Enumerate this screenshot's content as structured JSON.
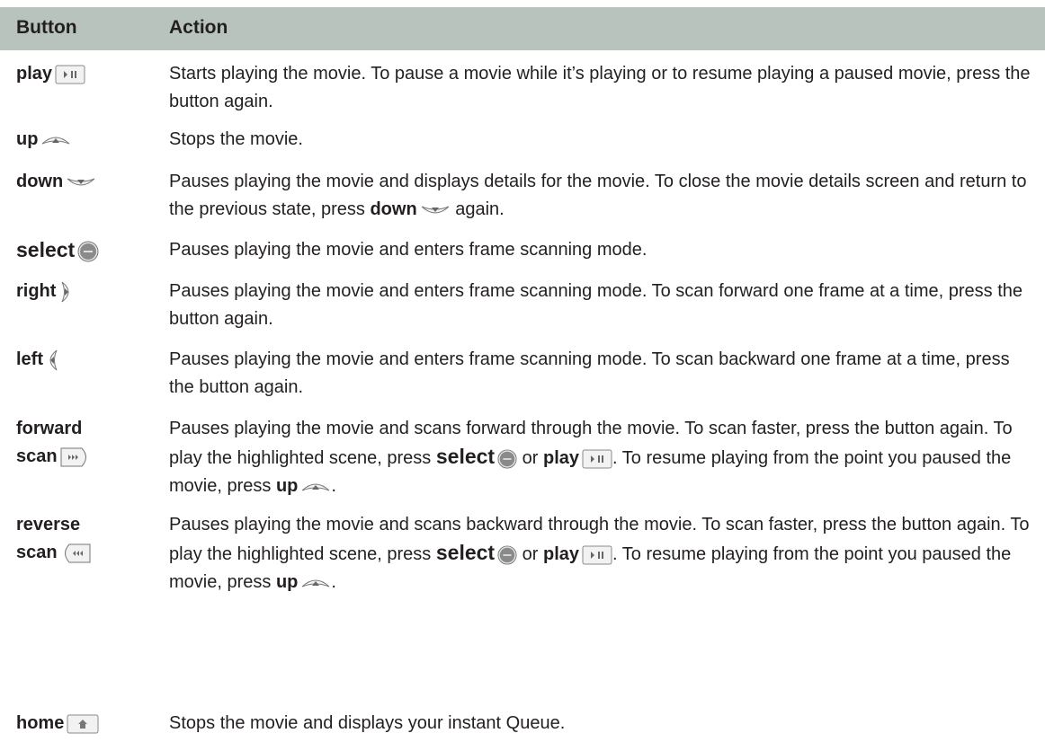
{
  "header": {
    "col_button": "Button",
    "col_action": "Action"
  },
  "rows": [
    {
      "button": "play",
      "icon": "play-pause-icon",
      "action": "Starts playing the movie. To pause a movie while it’s playing or to resume playing a paused movie, press the button again."
    },
    {
      "button": "up",
      "icon": "up-arrow-icon",
      "action": "Stops the movie."
    },
    {
      "button": "down",
      "icon": "down-arrow-icon",
      "action": {
        "text1": "Pauses playing the movie and displays details for the movie. To close the movie details screen and return to the previous state, press ",
        "bold1": "down",
        "text2": " again."
      }
    },
    {
      "button": "select",
      "icon": "select-icon",
      "action": "Pauses playing the movie and enters frame scanning mode."
    },
    {
      "button": "right",
      "icon": "right-arrow-icon",
      "action": "Pauses playing the movie and enters frame scanning mode. To scan forward one frame at a time, press the button again."
    },
    {
      "button": "left",
      "icon": "left-arrow-icon",
      "action": "Pauses playing the movie and enters frame scanning mode. To scan backward one frame at a time, press the button again."
    },
    {
      "button_line1": "forward",
      "button_line2": "scan",
      "icon": "forward-scan-icon",
      "action": {
        "text1": "Pauses playing the movie and scans forward through the movie. To scan faster, press the button again. To play the highlighted scene, press ",
        "bold1": "select",
        "text2": " or ",
        "bold2": "play",
        "text3": ". To resume playing from the point you paused the movie, press ",
        "bold3": "up",
        "text4": "."
      }
    },
    {
      "button_line1": "reverse",
      "button_line2": "scan",
      "icon": "reverse-scan-icon",
      "action": {
        "text1": "Pauses playing the movie and scans backward through the movie. To scan faster, press the button again. To play the highlighted scene, press ",
        "bold1": "select",
        "text2": " or ",
        "bold2": "play",
        "text3": ". To resume playing from the point you paused the movie, press ",
        "bold3": "up",
        "text4": "."
      }
    },
    {
      "button": "home",
      "icon": "home-icon",
      "action": "Stops the movie and displays your instant Queue."
    }
  ]
}
